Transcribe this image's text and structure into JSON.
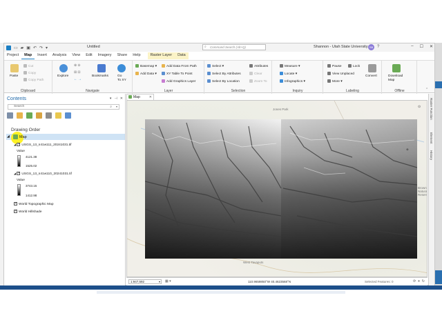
{
  "app": {
    "title": "Untitled",
    "command_search_placeholder": "Command Search (Alt+Q)",
    "user": "Shannon - Utah State University",
    "user_initials": "SB",
    "help": "?"
  },
  "tabs": [
    {
      "label": "Project"
    },
    {
      "label": "Map"
    },
    {
      "label": "Insert"
    },
    {
      "label": "Analysis"
    },
    {
      "label": "View"
    },
    {
      "label": "Edit"
    },
    {
      "label": "Imagery"
    },
    {
      "label": "Share"
    },
    {
      "label": "Help"
    },
    {
      "label": "Raster Layer"
    },
    {
      "label": "Data"
    }
  ],
  "ribbon": {
    "clipboard": {
      "label": "Clipboard",
      "paste": "Paste",
      "cut": "Cut",
      "copy": "Copy",
      "copy_path": "Copy Path"
    },
    "navigate": {
      "label": "Navigate",
      "explore": "Explore",
      "bookmarks": "Bookmarks",
      "go_to_xy": "Go\nTo XY"
    },
    "layer": {
      "label": "Layer",
      "basemap": "Basemap",
      "add_data": "Add Data",
      "add_data_from_path": "Add Data From Path",
      "xy_table": "XY Table To Point",
      "add_graphics": "Add Graphics Layer"
    },
    "selection": {
      "label": "Selection",
      "select": "Select",
      "select_by_attributes": "Select By Attributes",
      "select_by_location": "Select By Location",
      "attributes": "Attributes",
      "clear": "Clear",
      "zoom_to": "Zoom To"
    },
    "inquiry": {
      "label": "Inquiry",
      "measure": "Measure",
      "locate": "Locate",
      "infographics": "Infographics"
    },
    "labeling": {
      "label": "Labeling",
      "pause": "Pause",
      "lock": "Lock",
      "view_unplaced": "View Unplaced",
      "more": "More",
      "convert": "Convert"
    },
    "offline": {
      "label": "Offline",
      "download_map": "Download\nMap"
    }
  },
  "contents": {
    "title": "Contents",
    "search_placeholder": "Search",
    "drawing_order": "Drawing Order",
    "map_node": "Map",
    "layers": [
      {
        "name": "USGS_13_n41w111_20241031.tif",
        "value_label": "Value",
        "high": "4121.38",
        "low": "1525.02"
      },
      {
        "name": "USGS_13_n41w110_20241031.tif",
        "value_label": "Value",
        "high": "3743.15",
        "low": "1412.98"
      }
    ],
    "basemaps": [
      {
        "name": "World Topographic Map"
      },
      {
        "name": "World Hillshade"
      }
    ]
  },
  "map": {
    "tab_label": "Map",
    "places": [
      "Jones Park",
      "West Tavaputs",
      "Brown Natural Reserve"
    ],
    "scale": "1:947,592",
    "coordinates": "110.9659850°W 40.4623568°N",
    "selected_features": "Selected Features: 0"
  },
  "right_panel": {
    "tabs": [
      "Raster Function",
      "Element",
      "History"
    ]
  },
  "colors": {
    "accent": "#1b7fc4",
    "selection_highlight": "#cfe3f5",
    "cursor_highlight": "#fff000"
  }
}
